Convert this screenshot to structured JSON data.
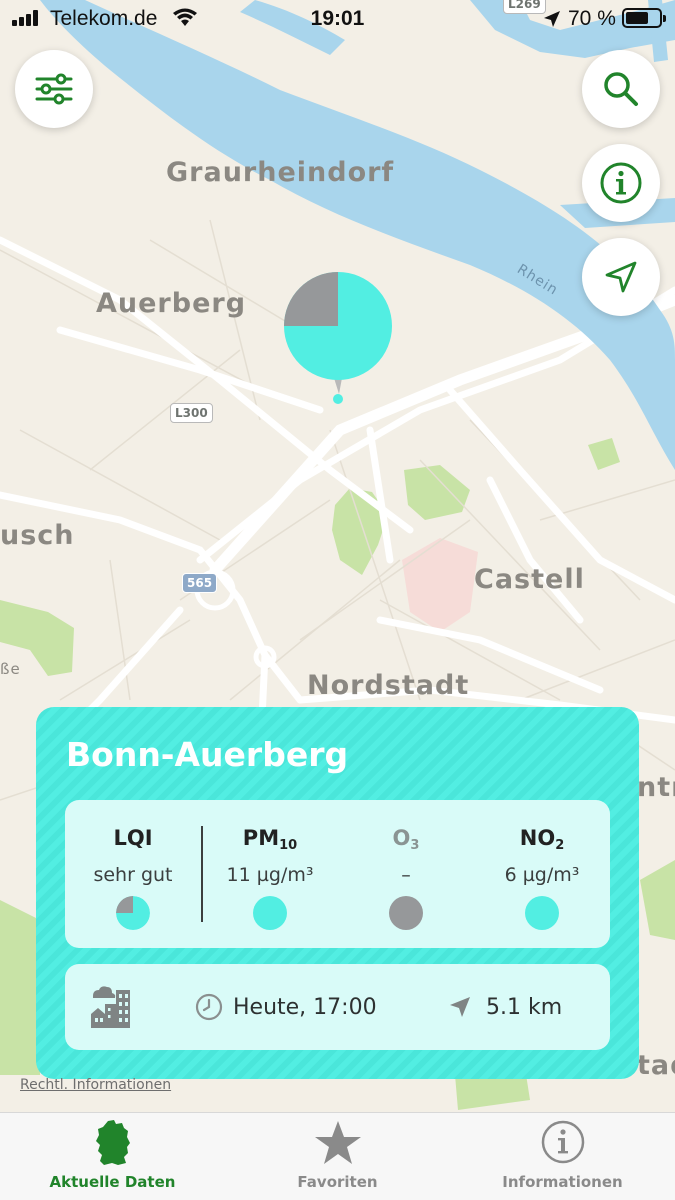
{
  "status_bar": {
    "carrier": "Telekom.de",
    "time": "19:01",
    "battery": "70 %",
    "battery_level": 0.7
  },
  "map": {
    "labels": {
      "graurheindorf": "Graurheindorf",
      "auerberg": "Auerberg",
      "usch": "usch",
      "castell": "Castell",
      "nordstadt": "Nordstadt",
      "rhein": "Rhein",
      "sse": "ße",
      "ntru": "ntru",
      "tad": "tad"
    },
    "road_shields": {
      "l269": "L269",
      "l300": "L300",
      "r565": "565"
    },
    "marker": {
      "good_fraction": 0.75,
      "good_color": "#52eee2",
      "none_color": "#96989a"
    },
    "colors": {
      "water": "#a9d5ec",
      "land": "#f3efe6",
      "park": "#c8e3a6",
      "hospital": "#f6dcd8"
    }
  },
  "buttons": {
    "filter": "sliders-icon",
    "search": "search-icon",
    "info": "info-icon",
    "locate": "location-arrow-icon"
  },
  "station": {
    "name": "Bonn-Auerberg",
    "lqi": {
      "label": "LQI",
      "value": "sehr gut"
    },
    "pm10": {
      "label": "PM",
      "sub": "10",
      "value": "11 µg/m³",
      "color": "#52eee2"
    },
    "o3": {
      "label": "O",
      "sub": "3",
      "value": "–",
      "color": "#96989a"
    },
    "no2": {
      "label": "NO",
      "sub": "2",
      "value": "6 µg/m³",
      "color": "#52eee2"
    },
    "station_type_icon": "city-building-icon",
    "time": "Heute, 17:00",
    "distance": "5.1 km"
  },
  "legal_link": "Rechtl. Informationen",
  "tabs": [
    {
      "label": "Aktuelle Daten",
      "icon": "germany-map-icon",
      "active": true
    },
    {
      "label": "Favoriten",
      "icon": "star-icon",
      "active": false
    },
    {
      "label": "Informationen",
      "icon": "info-circle-icon",
      "active": false
    }
  ],
  "colors": {
    "accent_green": "#21842b",
    "card_turquoise": "#52eee2",
    "panel_bg": "#d9fbf8"
  }
}
